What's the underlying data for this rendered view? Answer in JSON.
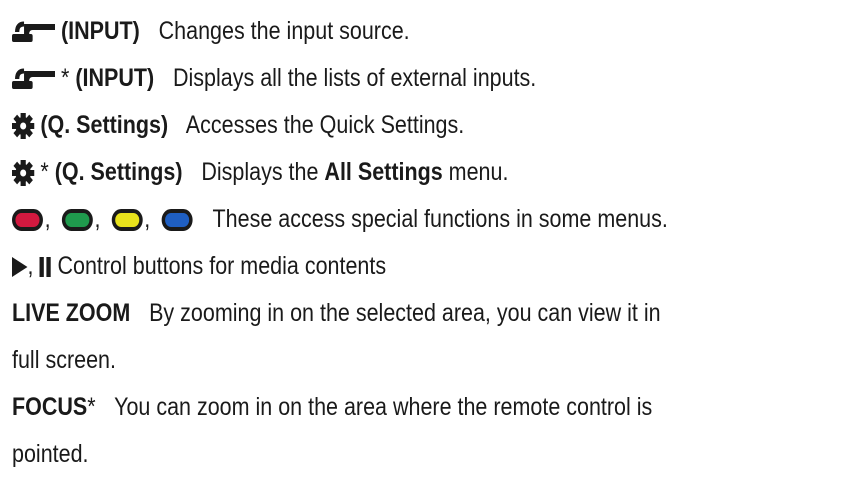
{
  "lines": [
    {
      "label": "(INPUT)",
      "text": "Changes the input source.",
      "icon": "input-plug-icon",
      "asterisk": ""
    },
    {
      "label": "(INPUT)",
      "text": "Displays all the lists of external inputs.",
      "icon": "input-plug-icon",
      "asterisk": "*"
    },
    {
      "label": "(Q. Settings)",
      "text": "Accesses the Quick Settings.",
      "icon": "gear-icon",
      "asterisk": ""
    },
    {
      "label": "(Q. Settings)",
      "text_before": "Displays the",
      "text_bold": "All Settings",
      "text_after": "menu.",
      "icon": "gear-icon",
      "asterisk": "*"
    },
    {
      "text": "These access special functions in some menus.",
      "buttons": [
        "red",
        "green",
        "yellow",
        "blue"
      ],
      "separator": ","
    },
    {
      "play_sep": ",",
      "text": "Control buttons for media contents"
    },
    {
      "label": "LIVE ZOOM",
      "text": "By zooming in on the selected area, you can view it in"
    },
    {
      "text": "full screen."
    },
    {
      "label": "FOCUS",
      "asterisk": "*",
      "text": "You can zoom in on the area where the remote control is"
    },
    {
      "text": "pointed."
    }
  ],
  "colors": {
    "red": "#d2193f",
    "green": "#1f9a4d",
    "yellow": "#e8e21c",
    "blue": "#1f5fc2",
    "text": "#1a1a1a"
  }
}
